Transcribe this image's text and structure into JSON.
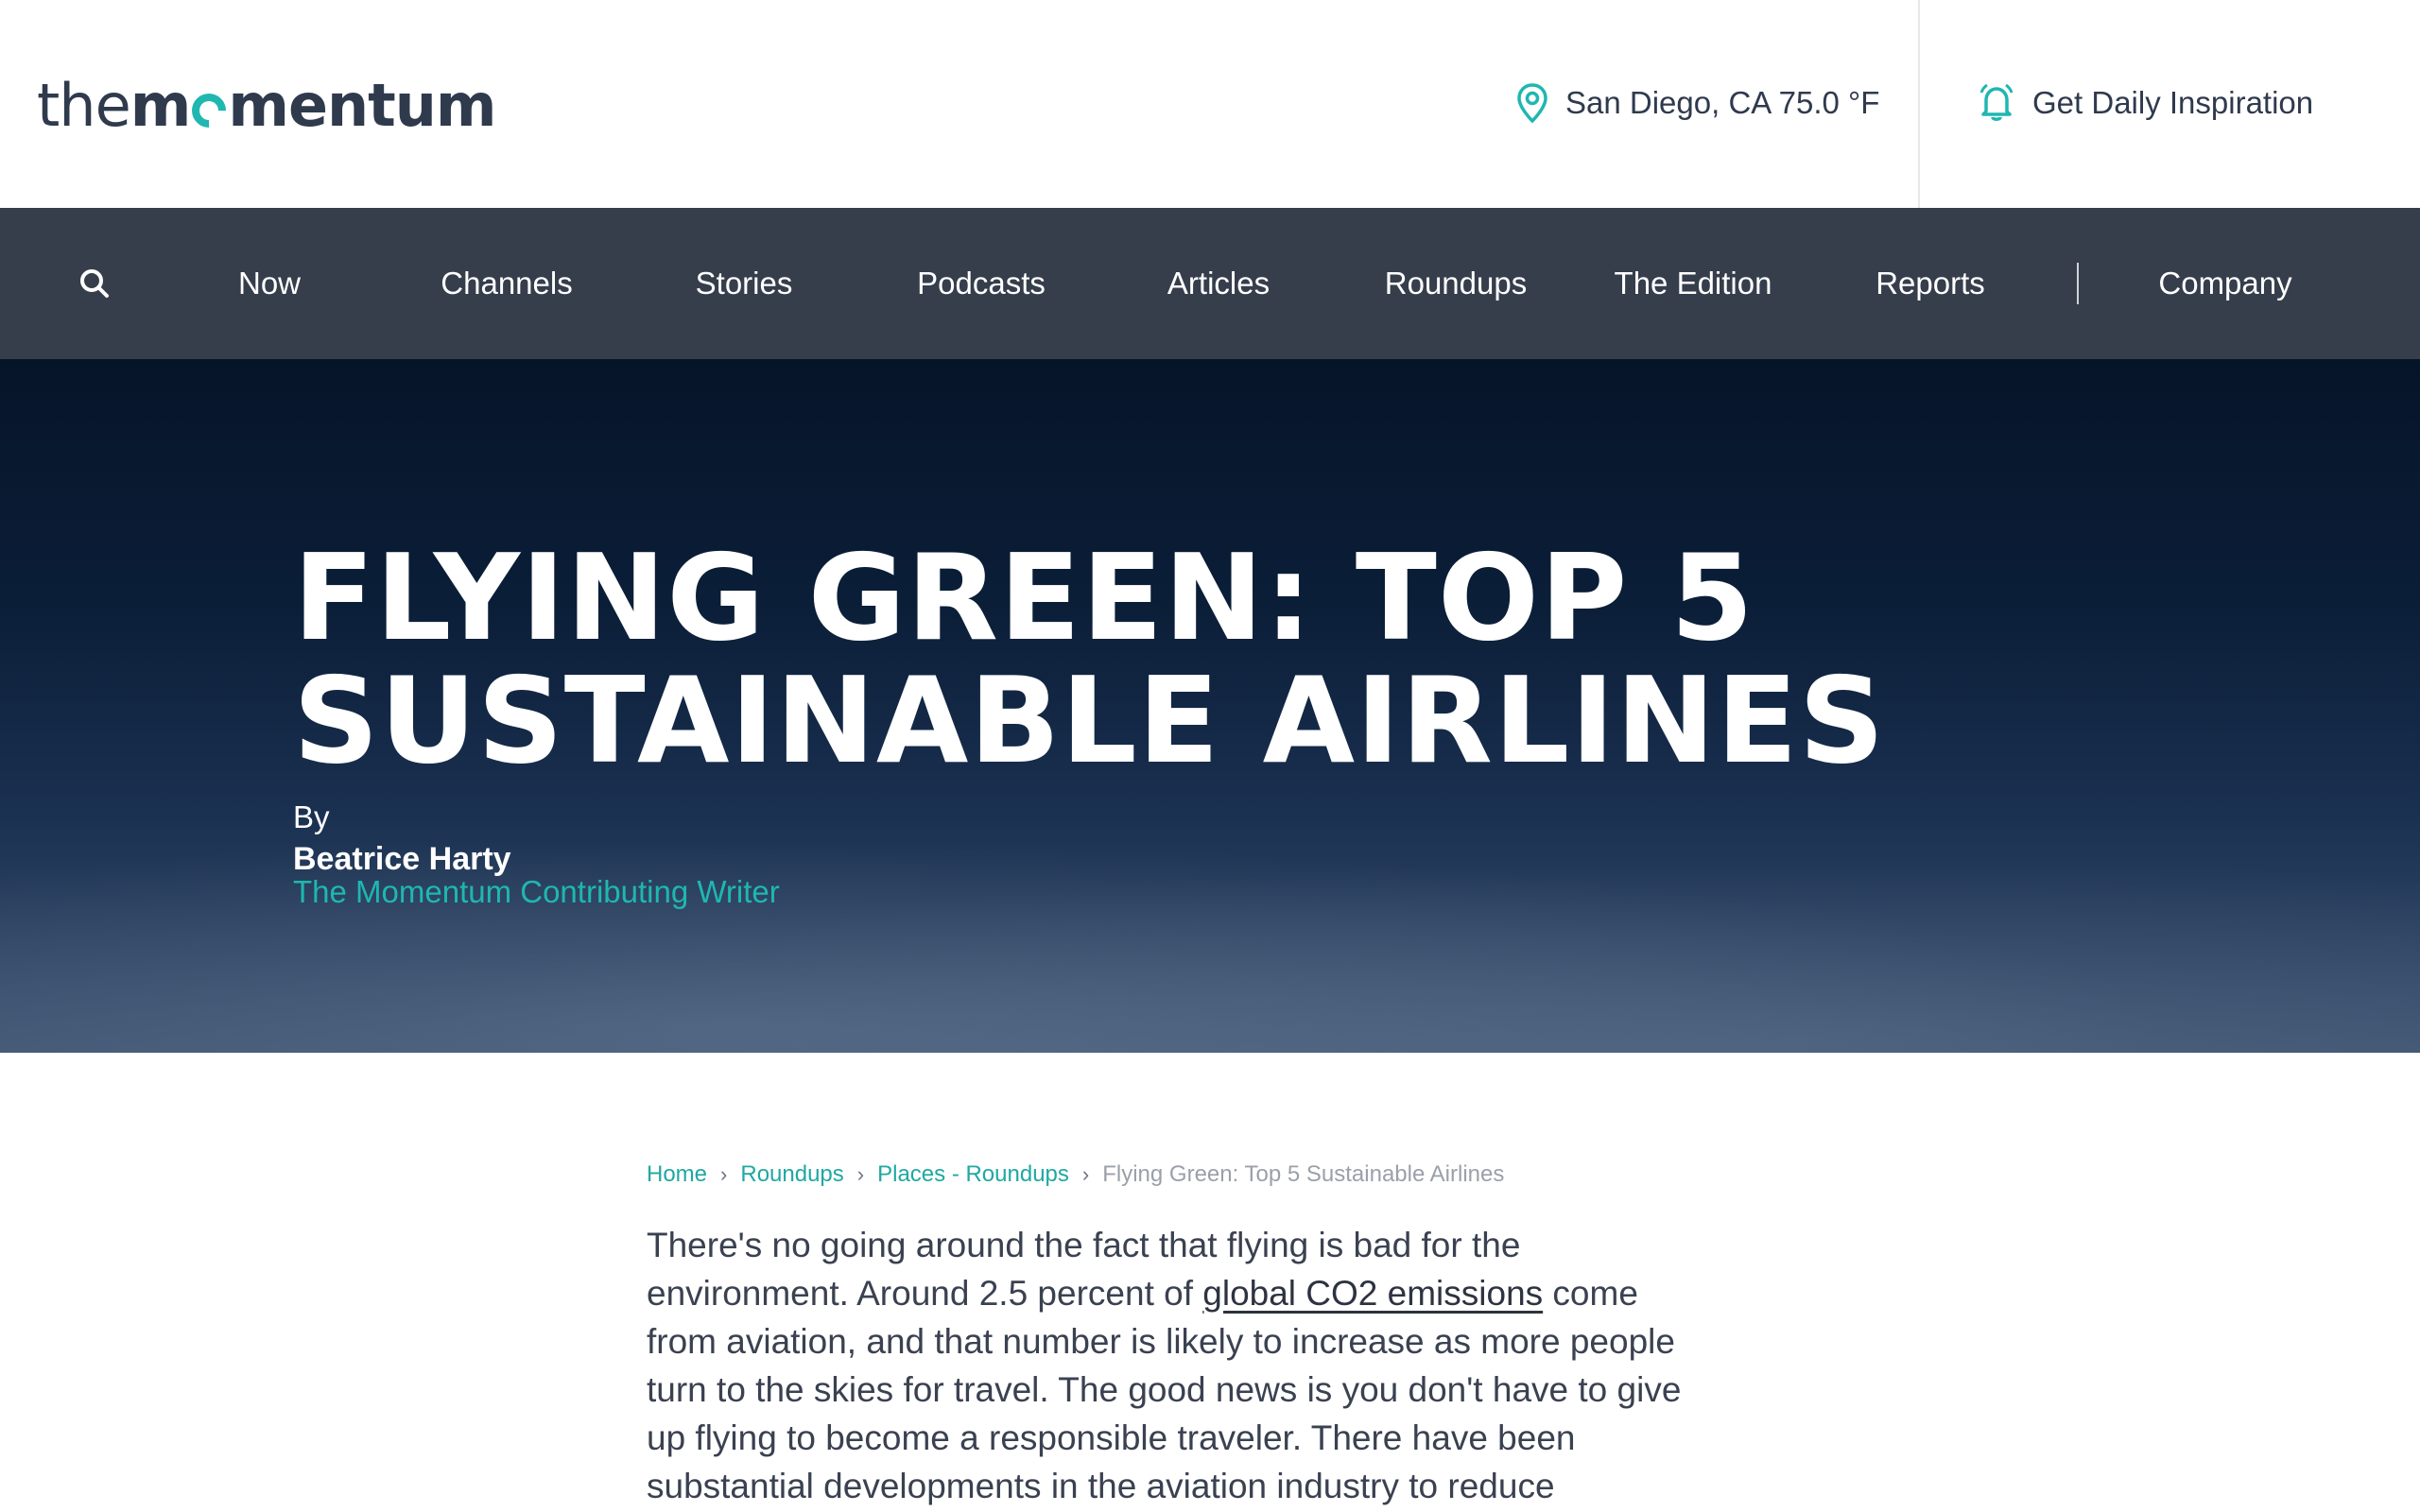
{
  "header": {
    "logo_the": "the",
    "logo_mom": "m",
    "logo_rest": "mentum",
    "location_icon": "map-pin-icon",
    "location": "San Diego, CA 75.0 °F",
    "inspiration_icon": "bell-icon",
    "inspiration": "Get Daily Inspiration"
  },
  "nav": {
    "search_icon": "search-icon",
    "items": [
      "Now",
      "Channels",
      "Stories",
      "Podcasts",
      "Articles",
      "Roundups",
      "The Edition",
      "Reports",
      "Company"
    ]
  },
  "hero": {
    "title_line1": "FLYING GREEN: TOP 5",
    "title_line2": "SUSTAINABLE AIRLINES",
    "by": "By",
    "author": "Beatrice Harty",
    "role": "The Momentum Contributing Writer"
  },
  "breadcrumb": {
    "items": [
      "Home",
      "Roundups",
      "Places - Roundups"
    ],
    "current": "Flying Green: Top 5 Sustainable Airlines",
    "separator": "›"
  },
  "article": {
    "lines": [
      "There's no going around the fact that flying is bad for the",
      "environment. Around 2.5 percent of ",
      " come",
      "from aviation, and that number is likely to increase as more people",
      "turn to the skies for travel. The good news is you don't have to give",
      "up flying to become a responsible traveler. There have been",
      "substantial developments in the aviation industry to reduce"
    ],
    "link": "global CO2 emissions"
  },
  "colors": {
    "accent": "#1fb7b0",
    "nav_bg": "#363e4c",
    "hero_dark": "#061428"
  }
}
